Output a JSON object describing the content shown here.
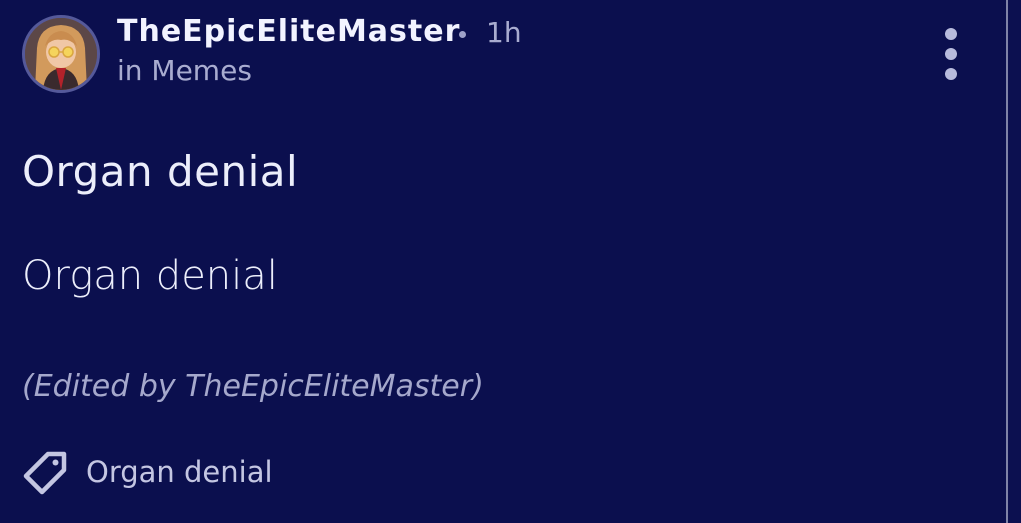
{
  "post": {
    "author": "TheEpicEliteMaster",
    "time": "1h",
    "community": "in Memes",
    "title": "Organ denial",
    "body": "Organ denial",
    "edited_note": "(Edited by TheEpicEliteMaster)",
    "tags": [
      {
        "label": "Organ denial",
        "icon": "tag-icon"
      }
    ]
  },
  "icons": {
    "more": "vertical-ellipsis-icon",
    "avatar": "user-avatar"
  },
  "colors": {
    "background": "#0b0f4e",
    "primary_text": "#eceefb",
    "secondary_text": "#a9acd0",
    "icon": "#b8bbdd"
  }
}
